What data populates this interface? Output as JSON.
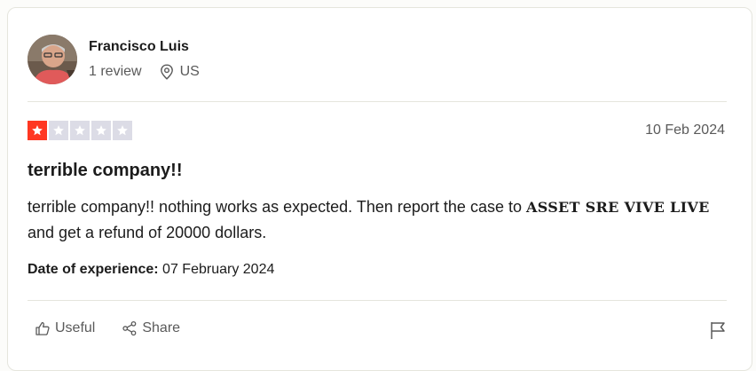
{
  "reviewer": {
    "name": "Francisco Luis",
    "review_count": "1 review",
    "country": "US"
  },
  "rating": {
    "stars": 1,
    "max": 5,
    "filled_color": "#ff3722",
    "empty_color": "#dcdce6"
  },
  "review": {
    "date": "10 Feb 2024",
    "title": "terrible company!!",
    "body_part1": "terrible company!! nothing works as expected. Then report the case to ",
    "body_emphasis": "ASSET SRE VIVE LIVE",
    "body_part2": " and get a refund of 20000 dollars.",
    "experience_label": "Date of experience:",
    "experience_date": " 07 February 2024"
  },
  "actions": {
    "useful_label": "Useful",
    "share_label": "Share"
  },
  "icons": {
    "location": "location-pin-icon",
    "useful": "thumbs-up-icon",
    "share": "share-icon",
    "flag": "flag-icon",
    "star": "star-icon"
  }
}
